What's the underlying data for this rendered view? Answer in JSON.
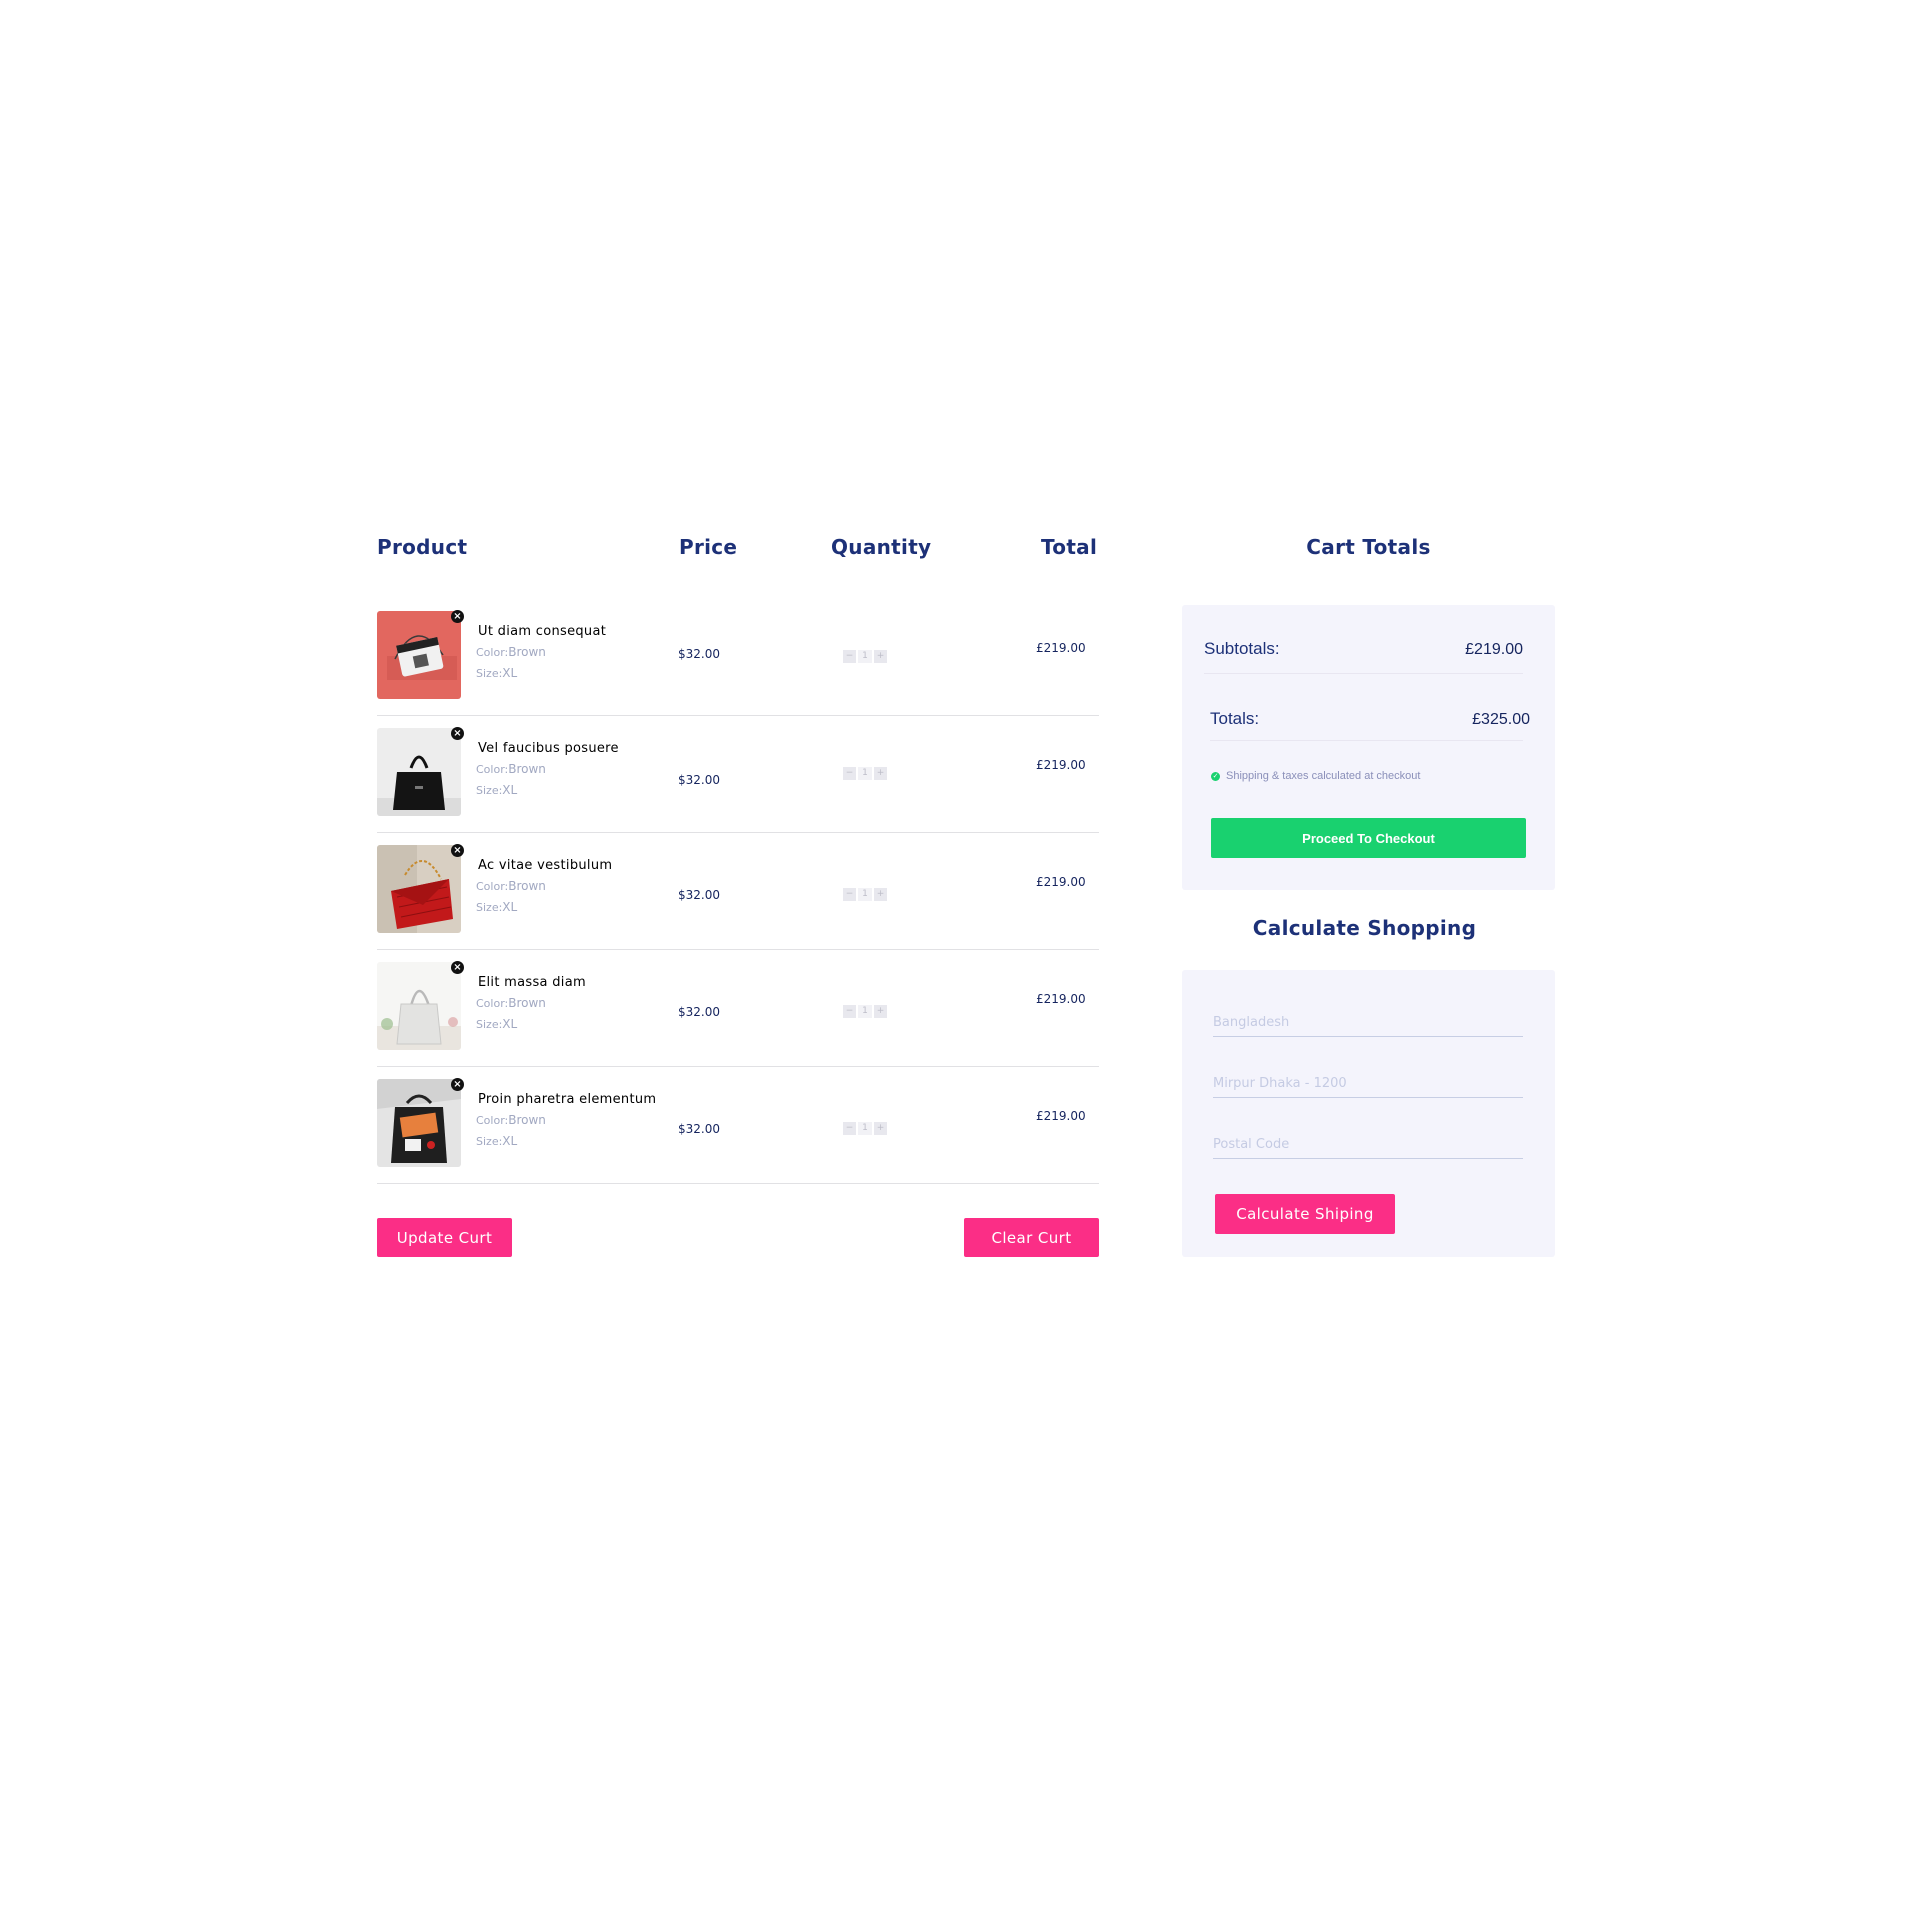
{
  "table": {
    "headers": {
      "product": "Product",
      "price": "Price",
      "quantity": "Quantity",
      "total": "Total"
    },
    "color_label": "Color:",
    "size_label": "Size:",
    "rows": [
      {
        "name": "Ut diam consequat",
        "color": "Brown",
        "size": "XL",
        "price": "$32.00",
        "qty": "1",
        "total": "£219.00",
        "image": "bag-red-background"
      },
      {
        "name": "Vel faucibus posuere",
        "color": "Brown",
        "size": "XL",
        "price": "$32.00",
        "qty": "1",
        "total": "£219.00",
        "image": "black-handbag"
      },
      {
        "name": "Ac vitae vestibulum",
        "color": "Brown",
        "size": "XL",
        "price": "$32.00",
        "qty": "1",
        "total": "£219.00",
        "image": "red-quilted-bag"
      },
      {
        "name": "Elit massa diam",
        "color": "Brown",
        "size": "XL",
        "price": "$32.00",
        "qty": "1",
        "total": "£219.00",
        "image": "white-tote-bag"
      },
      {
        "name": "Proin pharetra elementum",
        "color": "Brown",
        "size": "XL",
        "price": "$32.00",
        "qty": "1",
        "total": "£219.00",
        "image": "black-backpack"
      }
    ],
    "update_button": "Update Curt",
    "clear_button": "Clear Curt"
  },
  "cart_totals": {
    "title": "Cart Totals",
    "subtotals_label": "Subtotals:",
    "subtotals_value": "£219.00",
    "totals_label": "Totals:",
    "totals_value": "£325.00",
    "shipping_note": "Shipping & taxes calculated at checkout",
    "checkout_button": "Proceed To Checkout"
  },
  "calculate_shipping": {
    "title": "Calculate Shopping",
    "country_placeholder": "Bangladesh",
    "city_placeholder": "Mirpur Dhaka - 1200",
    "postal_placeholder": "Postal Code",
    "button": "Calculate Shiping"
  },
  "colors": {
    "navy": "#1D3178",
    "pink": "#FB2E86",
    "green": "#19D16F",
    "panel": "#F4F4FC",
    "muted": "#A1A8C1"
  }
}
